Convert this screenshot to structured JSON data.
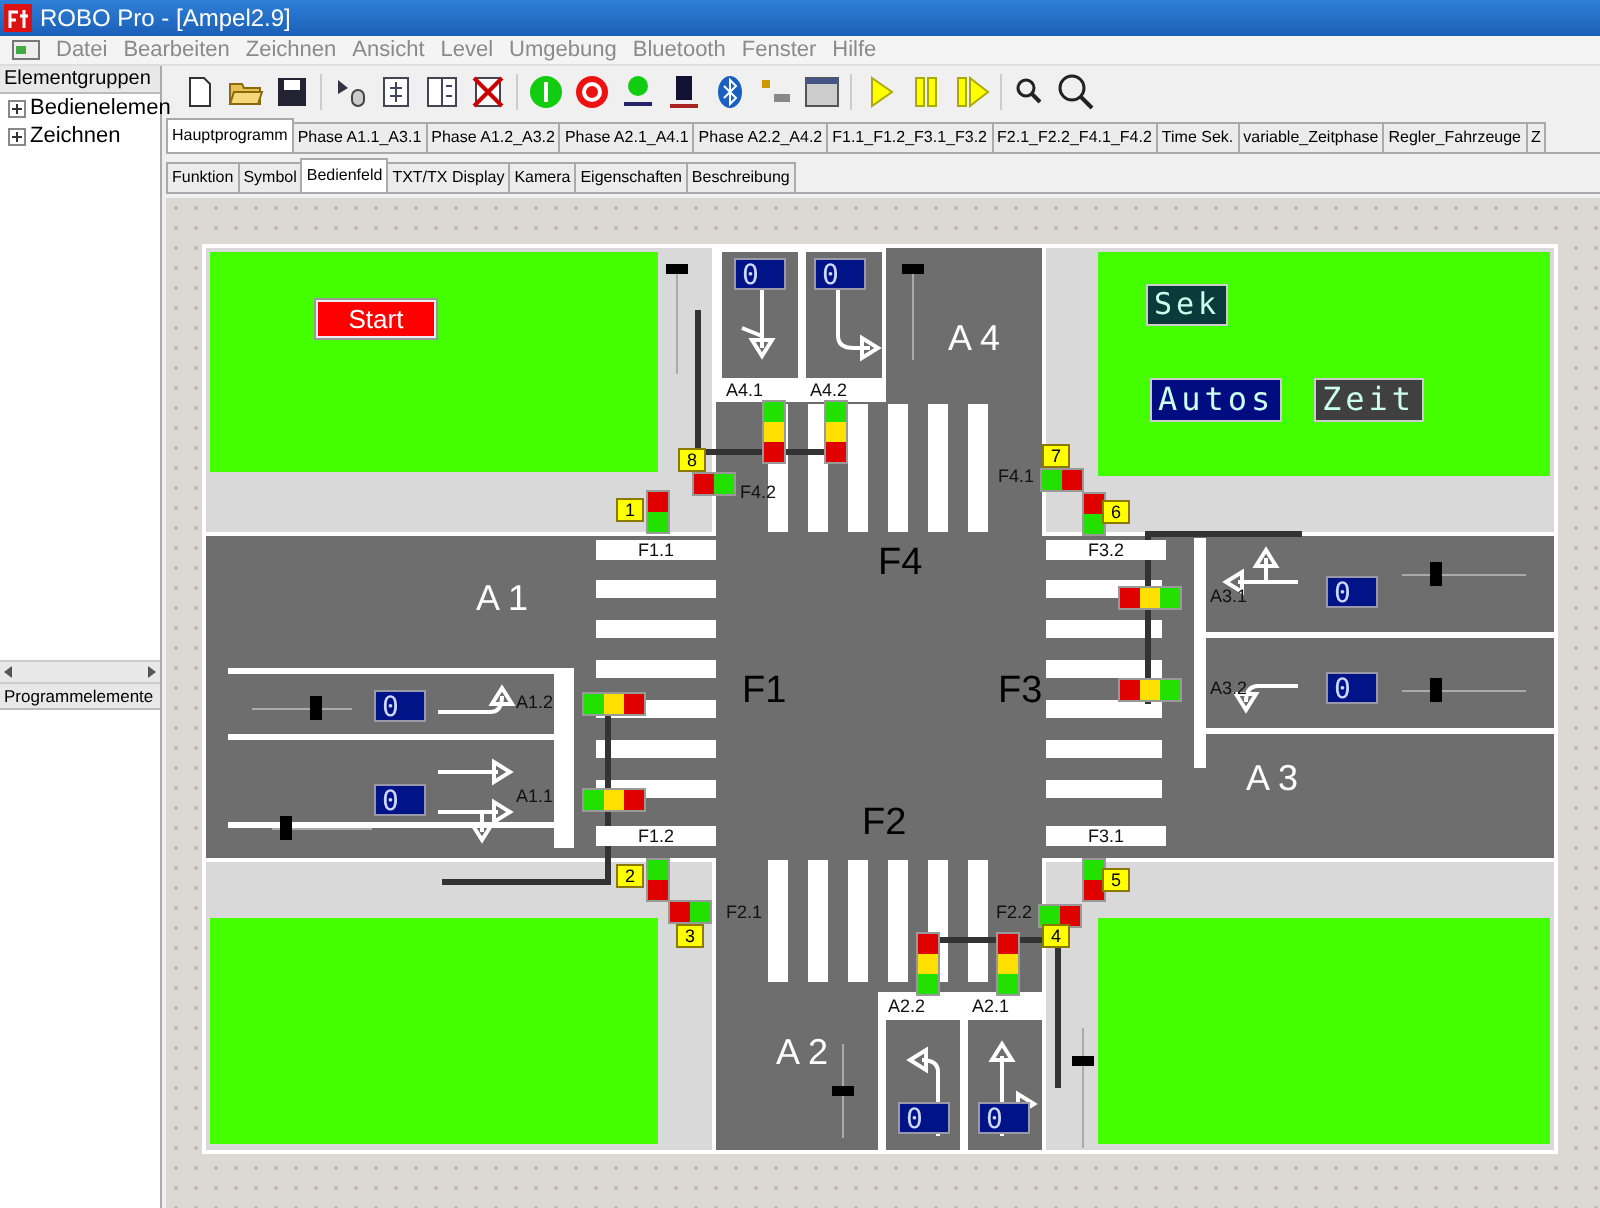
{
  "window": {
    "title": "ROBO Pro - [Ampel2.9]"
  },
  "menu": [
    "Datei",
    "Bearbeiten",
    "Zeichnen",
    "Ansicht",
    "Level",
    "Umgebung",
    "Bluetooth",
    "Fenster",
    "Hilfe"
  ],
  "sidebar": {
    "header": "Elementgruppen",
    "items": [
      {
        "label": "Bedienelemen",
        "expanded": false
      },
      {
        "label": "Zeichnen",
        "expanded": false
      }
    ],
    "lower_header": "Programmelemente"
  },
  "program_tabs": [
    {
      "label": "Hauptprogramm",
      "selected": true
    },
    {
      "label": "Phase A1.1_A3.1",
      "selected": false
    },
    {
      "label": "Phase A1.2_A3.2",
      "selected": false
    },
    {
      "label": "Phase A2.1_A4.1",
      "selected": false
    },
    {
      "label": "Phase A2.2_A4.2",
      "selected": false
    },
    {
      "label": "F1.1_F1.2_F3.1_F3.2",
      "selected": false
    },
    {
      "label": "F2.1_F2.2_F4.1_F4.2",
      "selected": false
    },
    {
      "label": "Time Sek.",
      "selected": false
    },
    {
      "label": "variable_Zeitphase",
      "selected": false
    },
    {
      "label": "Regler_Fahrzeuge",
      "selected": false
    },
    {
      "label": "Z",
      "selected": false
    }
  ],
  "view_tabs": [
    {
      "label": "Funktion",
      "selected": false
    },
    {
      "label": "Symbol",
      "selected": false
    },
    {
      "label": "Bedienfeld",
      "selected": true
    },
    {
      "label": "TXT/TX Display",
      "selected": false
    },
    {
      "label": "Kamera",
      "selected": false
    },
    {
      "label": "Eigenschaften",
      "selected": false
    },
    {
      "label": "Beschreibung",
      "selected": false
    }
  ],
  "canvas": {
    "start_button": "Start",
    "text_displays": [
      {
        "text": "Sek",
        "color": "#0a3a3a"
      },
      {
        "text": "Autos",
        "color": "#000c80"
      },
      {
        "text": "Zeit",
        "color": "#404040"
      }
    ],
    "area_labels": [
      "A 4",
      "A 1",
      "A 3",
      "A 2"
    ],
    "zone_labels": [
      "F4",
      "F1",
      "F3",
      "F2"
    ],
    "lane_labels": [
      "A4.1",
      "A4.2",
      "A2.2",
      "A2.1"
    ],
    "crossing_labels": [
      "F1.1",
      "F3.2",
      "F1.2",
      "F3.1"
    ],
    "light_labels": [
      "F4.2",
      "F4.1",
      "F2.1",
      "F2.2",
      "A1.2",
      "A1.1",
      "A3.1",
      "A3.2"
    ],
    "tags": [
      "1",
      "2",
      "3",
      "4",
      "5",
      "6",
      "7",
      "8"
    ],
    "counters": [
      "0",
      "0",
      "0",
      "0",
      "0",
      "0",
      "0",
      "0"
    ],
    "sliders": [
      {
        "level": 1
      },
      {
        "level": 1
      },
      {
        "level": 0.65
      },
      {
        "level": 0.1
      },
      {
        "level": 0.25
      },
      {
        "level": 0.25
      },
      {
        "level": 0.5
      },
      {
        "level": 0.75
      }
    ]
  }
}
